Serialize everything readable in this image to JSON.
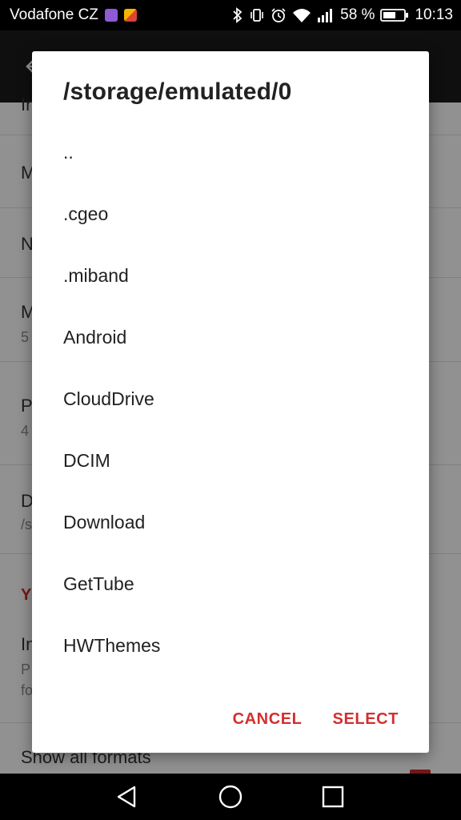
{
  "status_bar": {
    "carrier": "Vodafone CZ",
    "battery_percent": "58 %",
    "time": "10:13",
    "icons": [
      "bluetooth-icon",
      "vibrate-icon",
      "alarm-icon",
      "wifi-icon",
      "signal-icon",
      "battery-icon"
    ]
  },
  "background": {
    "rows": [
      {
        "title": "In",
        "subtitle": ""
      },
      {
        "title": "M",
        "subtitle": ""
      },
      {
        "title": "N",
        "subtitle": ""
      },
      {
        "title": "M",
        "subtitle": "5"
      },
      {
        "title": "P",
        "subtitle": "4"
      },
      {
        "title": "D",
        "subtitle": "/s"
      }
    ],
    "section_header": "Y",
    "row_after_section": {
      "title": "In",
      "subtitle": "P",
      "subtitle2": "fo"
    },
    "last_row_title": "Show all formats"
  },
  "dialog": {
    "title": "/storage/emulated/0",
    "items": [
      "..",
      ".cgeo",
      ".miband",
      "Android",
      "CloudDrive",
      "DCIM",
      "Download",
      "GetTube",
      "HWThemes"
    ],
    "cancel_label": "CANCEL",
    "select_label": "SELECT"
  },
  "colors": {
    "accent": "#d32f2f",
    "status_bar": "#000000"
  }
}
